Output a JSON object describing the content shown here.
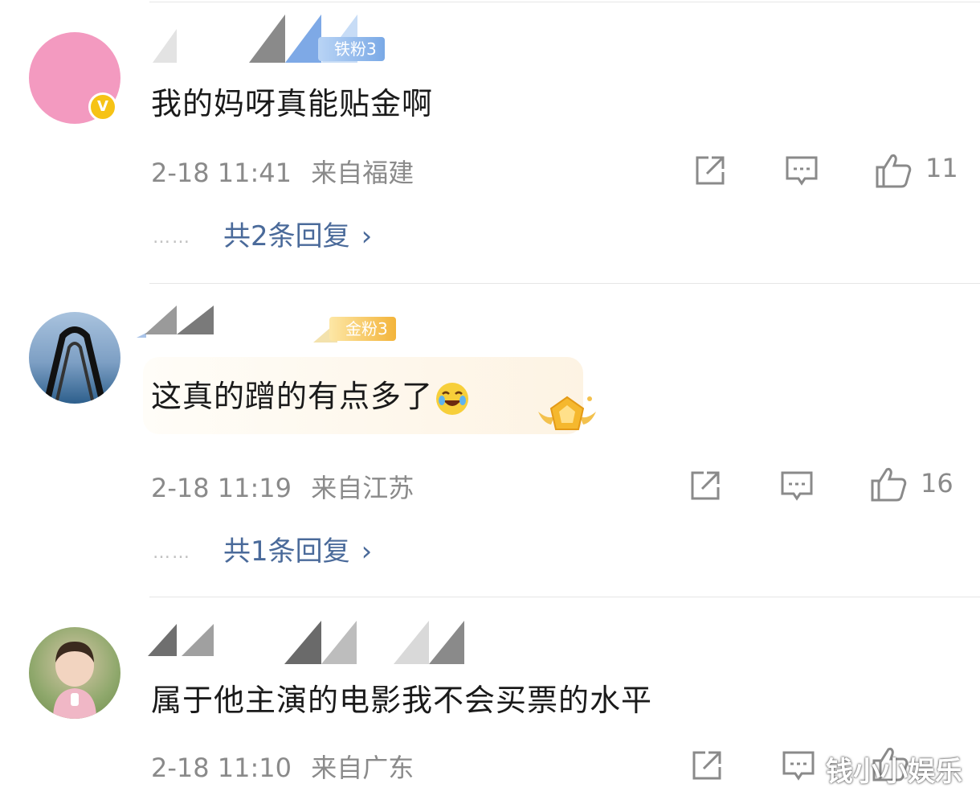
{
  "comments": [
    {
      "fan_badge": "铁粉3",
      "text": "我的妈呀真能贴金啊",
      "time": "2-18 11:41",
      "location": "来自福建",
      "likes": "11",
      "replies": "共2条回复",
      "verified_badge": "V",
      "avatar_color": "#f39ac0"
    },
    {
      "fan_badge": "金粉3",
      "text": "这真的蹭的有点多了",
      "time": "2-18 11:19",
      "location": "来自江苏",
      "likes": "16",
      "replies": "共1条回复"
    },
    {
      "text": "属于他主演的电影我不会买票的水平",
      "time": "2-18 11:10",
      "location": "来自广东"
    }
  ],
  "reply_dots": "……",
  "reply_chevron": "›",
  "watermark": "钱小小娱乐",
  "icons": {
    "share": "share-icon",
    "comment": "comment-icon",
    "like": "thumbs-up-icon",
    "emoji": "laughing-emoji-icon",
    "medal": "gold-medal-icon"
  }
}
